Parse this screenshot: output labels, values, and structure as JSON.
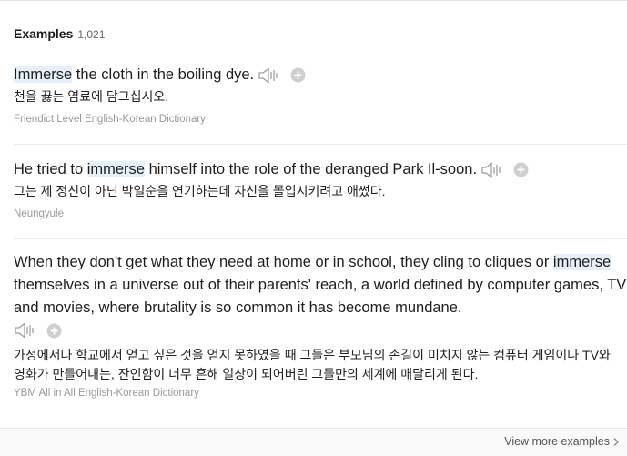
{
  "section": {
    "title": "Examples",
    "count": "1,021"
  },
  "examples": [
    {
      "en_pre": "",
      "en_hl": "Immerse",
      "en_post": " the cloth in the boiling dye.",
      "ko": "천을 끓는 염료에 담그십시오.",
      "source": "Friendict Level English-Korean Dictionary"
    },
    {
      "en_pre": "He tried to ",
      "en_hl": "immerse",
      "en_post": " himself into the role of the deranged Park Il-soon.",
      "ko": "그는 제 정신이 아닌 박일순을 연기하는데 자신을 몰입시키려고 애썼다.",
      "source": "Neungyule"
    },
    {
      "en_pre": "When they don't get what they need at home or in school, they cling to cliques or ",
      "en_hl": "immerse",
      "en_post": " themselves in a universe out of their parents' reach, a world defined by computer games, TV and movies, where brutality is so common it has become mundane.",
      "ko": "가정에서나 학교에서 얻고 싶은 것을 얻지 못하였을 때 그들은 부모님의 손길이 미치지 않는 컴퓨터 게임이나 TV와 영화가 만들어내는, 잔인함이 너무 흔해 일상이 되어버린 그들만의 세계에 매달리게 된다.",
      "source": "YBM All in All English-Korean Dictionary"
    }
  ],
  "footer": {
    "more_label": "View more examples"
  },
  "icons": {
    "speaker": "speaker-icon",
    "add": "plus-circle-icon",
    "more": "chevron-right-icon"
  },
  "colors": {
    "highlight": "#e6f0fb",
    "source_text": "#999999",
    "icon_gray": "#b5b5b5"
  }
}
